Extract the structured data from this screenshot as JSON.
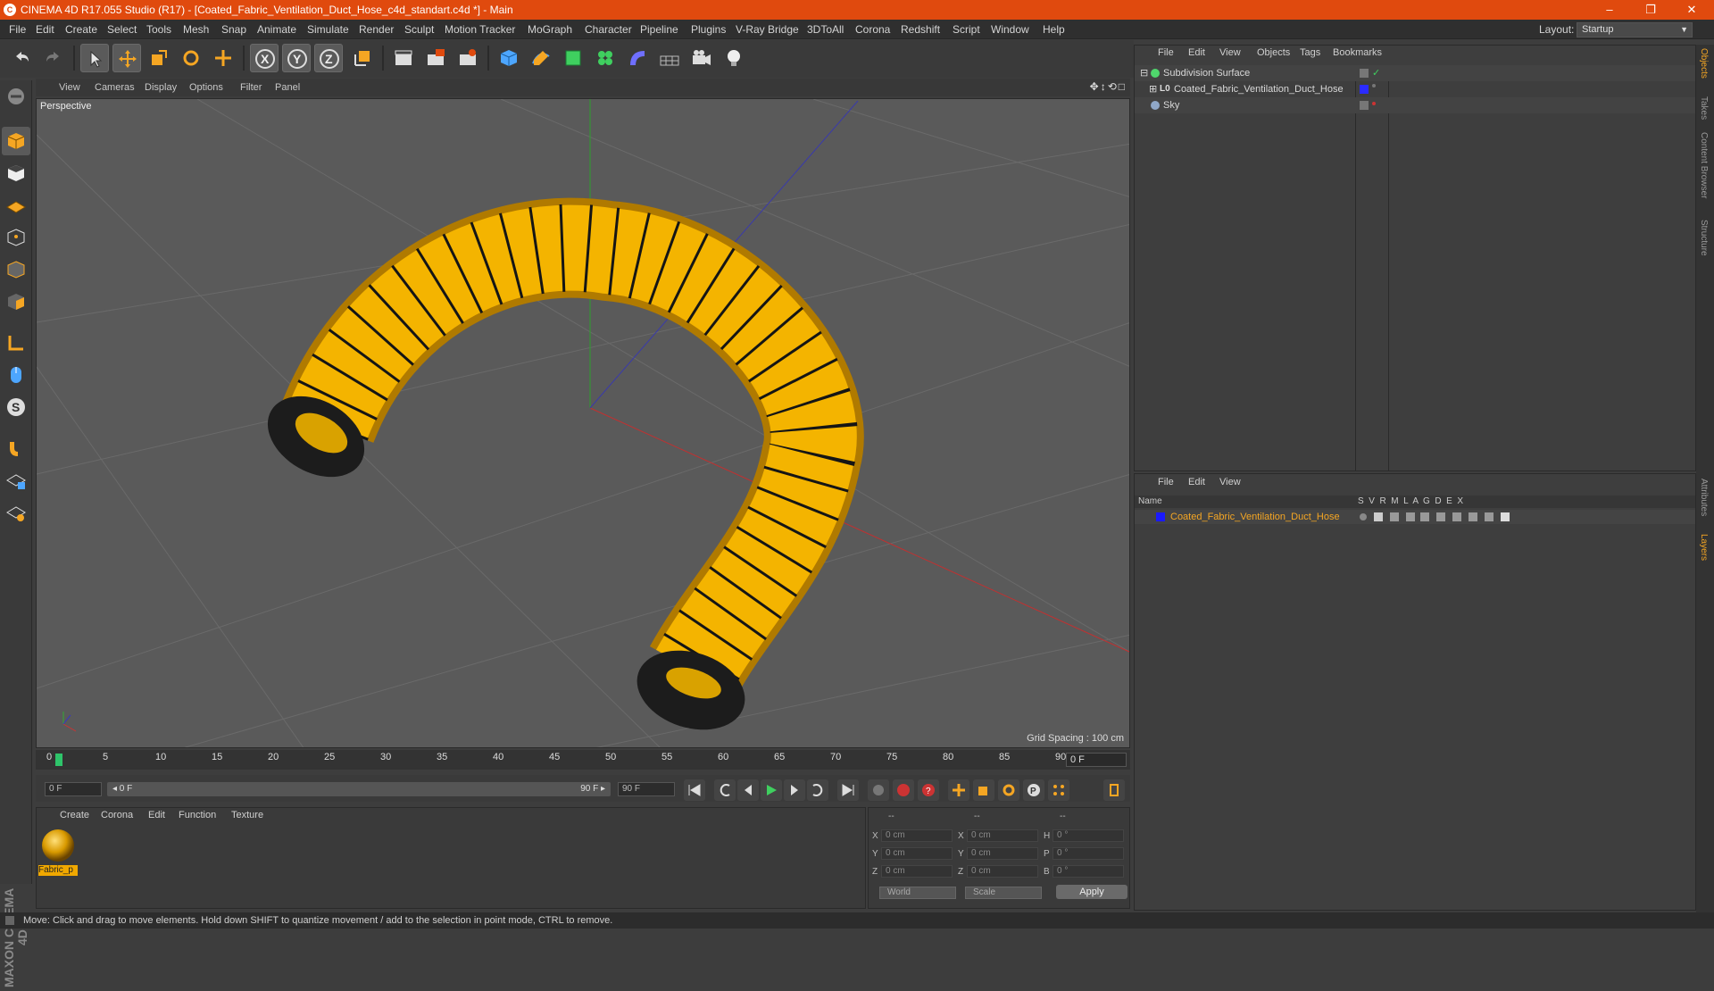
{
  "window": {
    "title": "CINEMA 4D R17.055 Studio (R17) - [Coated_Fabric_Ventilation_Duct_Hose_c4d_standart.c4d *] - Main",
    "min": "–",
    "max": "❐",
    "close": "✕"
  },
  "menu": [
    "File",
    "Edit",
    "Create",
    "Select",
    "Tools",
    "Mesh",
    "Snap",
    "Animate",
    "Simulate",
    "Render",
    "Sculpt",
    "Motion Tracker",
    "MoGraph",
    "Character",
    "Pipeline",
    "Plugins",
    "V-Ray Bridge",
    "3DToAll",
    "Corona",
    "Redshift",
    "Script",
    "Window",
    "Help"
  ],
  "layout": {
    "label": "Layout:",
    "value": "Startup"
  },
  "viewport": {
    "menu": [
      "View",
      "Cameras",
      "Display",
      "Options",
      "Filter",
      "Panel"
    ],
    "title": "Perspective",
    "grid_spacing": "Grid Spacing : 100 cm",
    "nav_icons": "✥↕⟲□"
  },
  "timeline": {
    "ticks": [
      "0",
      "5",
      "10",
      "15",
      "20",
      "25",
      "30",
      "35",
      "40",
      "45",
      "50",
      "55",
      "60",
      "65",
      "70",
      "75",
      "80",
      "85",
      "90"
    ],
    "current_frame": "0 F"
  },
  "transport": {
    "start": "0 F",
    "range_start": "◂ 0 F",
    "range_end": "90 F ▸",
    "end": "90 F"
  },
  "materials": {
    "menu": [
      "Create",
      "Corona",
      "Edit",
      "Function",
      "Texture"
    ],
    "items": [
      {
        "name": "Fabric_p"
      }
    ]
  },
  "coords": {
    "header": [
      "--",
      "--",
      "--"
    ],
    "rows": [
      {
        "a": "X",
        "av": "0 cm",
        "b": "X",
        "bv": "0 cm",
        "c": "H",
        "cv": "0 °"
      },
      {
        "a": "Y",
        "av": "0 cm",
        "b": "Y",
        "bv": "0 cm",
        "c": "P",
        "cv": "0 °"
      },
      {
        "a": "Z",
        "av": "0 cm",
        "b": "Z",
        "bv": "0 cm",
        "c": "B",
        "cv": "0 °"
      }
    ],
    "mode1": "World",
    "mode2": "Scale",
    "apply": "Apply"
  },
  "objects": {
    "menu": [
      "File",
      "Edit",
      "View",
      "Objects",
      "Tags",
      "Bookmarks"
    ],
    "rows": [
      {
        "name": "Subdivision Surface",
        "color": "#4fd66c"
      },
      {
        "name": "Coated_Fabric_Ventilation_Duct_Hose",
        "color": "#2b2bff"
      },
      {
        "name": "Sky",
        "color": "#8fa7c8"
      }
    ]
  },
  "layers": {
    "menu": [
      "File",
      "Edit",
      "View"
    ],
    "header": {
      "name": "Name",
      "cols": "S  V  R  M  L  A  G  D  E  X"
    },
    "rows": [
      {
        "name": "Coated_Fabric_Ventilation_Duct_Hose",
        "color": "#1a1aff"
      }
    ]
  },
  "side_tabs": [
    "Objects",
    "Takes",
    "Content Browser",
    "Structure",
    "Attributes",
    "Layers"
  ],
  "status": "Move: Click and drag to move elements. Hold down SHIFT to quantize movement / add to the selection in point mode, CTRL to remove.",
  "brand": "MAXON CINEMA 4D",
  "colors": {
    "accent": "#e04a0e",
    "hose": "#f4b400",
    "hose_dark": "#b07a00",
    "band": "#151515"
  }
}
